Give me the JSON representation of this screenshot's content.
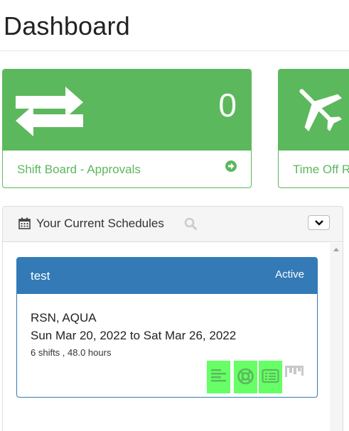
{
  "header": {
    "title": "Dashboard"
  },
  "cards": [
    {
      "count": "0",
      "label": "Shift Board - Approvals",
      "icon": "swap-arrows-icon",
      "arrow_icon": "circle-arrow-right-icon",
      "color": "#5cb85c"
    },
    {
      "label": "Time Off R",
      "icon": "plane-icon",
      "color": "#5cb85c"
    }
  ],
  "schedules_panel": {
    "title": "Your Current Schedules",
    "title_icon": "calendar-icon",
    "search_icon": "search-icon",
    "collapse_icon": "chevron-down-icon",
    "schedule": {
      "name": "test",
      "status": "Active",
      "location": "RSN, AQUA",
      "dates": "Sun Mar 20, 2022 to Sat Mar 26, 2022",
      "summary": "6 shifts , 48.0 hours",
      "header_color": "#337ab7",
      "actions": [
        {
          "icon": "align-left-icon",
          "highlight": "#66ff66"
        },
        {
          "icon": "life-ring-icon",
          "highlight": "#66ff66"
        },
        {
          "icon": "list-alt-icon",
          "highlight": "#66ff66"
        },
        {
          "icon": "trello-icon"
        }
      ]
    }
  }
}
